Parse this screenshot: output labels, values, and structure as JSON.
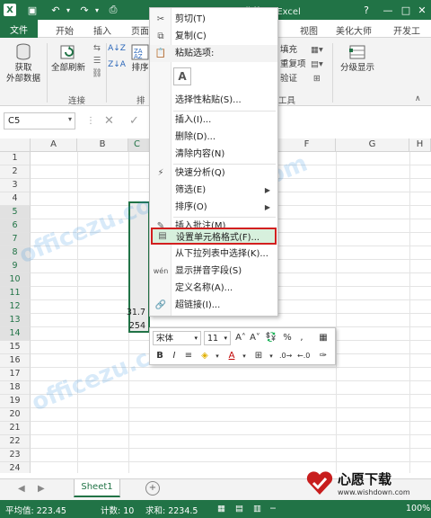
{
  "title_bar": {
    "title": "工作簿1 - Excel"
  },
  "ribbon_tabs": [
    "文件",
    "开始",
    "插入",
    "页面",
    "视图",
    "美化大师",
    "开发工"
  ],
  "ribbon": {
    "get_external": "获取\n外部数据",
    "refresh_all": "全部刷新",
    "group_connect": "连接",
    "sort": "排序",
    "group_sort_short": "排",
    "fill": "填充",
    "remove_dup": "重复项",
    "validate": "验证",
    "group_tools": "工具",
    "outline": "分级显示"
  },
  "formula_bar": {
    "name_box": "C5"
  },
  "columns": [
    "A",
    "B",
    "C",
    "D",
    "E",
    "F",
    "G",
    "H"
  ],
  "rows": [
    "1",
    "2",
    "3",
    "4",
    "5",
    "6",
    "7",
    "8",
    "9",
    "10",
    "11",
    "12",
    "13",
    "14",
    "15",
    "16",
    "17",
    "18",
    "19",
    "20",
    "21",
    "22",
    "23",
    "24"
  ],
  "visible_cell_values": {
    "row13": "31.7",
    "row14": "254"
  },
  "context_menu": {
    "items": [
      {
        "label": "剪切(T)",
        "icon": "scissors-icon"
      },
      {
        "label": "复制(C)",
        "icon": "copy-icon"
      },
      {
        "label": "粘贴选项:",
        "icon": "paste-icon"
      },
      {
        "label": "",
        "icon": "paste-a-icon"
      },
      {
        "label": "选择性粘贴(S)...",
        "icon": ""
      },
      {
        "label": "插入(I)...",
        "icon": ""
      },
      {
        "label": "删除(D)...",
        "icon": ""
      },
      {
        "label": "清除内容(N)",
        "icon": ""
      },
      {
        "label": "快速分析(Q)",
        "icon": "quick-analysis-icon"
      },
      {
        "label": "筛选(E)",
        "icon": ""
      },
      {
        "label": "排序(O)",
        "icon": ""
      },
      {
        "label": "插入批注(M)",
        "icon": "comment-icon"
      },
      {
        "label": "设置单元格格式(F)...",
        "icon": "format-cells-icon"
      },
      {
        "label": "从下拉列表中选择(K)...",
        "icon": ""
      },
      {
        "label": "显示拼音字段(S)",
        "icon": "phonetic-icon"
      },
      {
        "label": "定义名称(A)...",
        "icon": ""
      },
      {
        "label": "超链接(I)...",
        "icon": "hyperlink-icon"
      }
    ]
  },
  "mini_toolbar": {
    "font": "宋体",
    "size": "11",
    "pct": "%",
    "comma": ","
  },
  "sheet_tabs": [
    "Sheet1"
  ],
  "status": {
    "avg": "平均值: 223.45",
    "count": "计数: 10",
    "sum": "求和: 2234.5",
    "zoom": "100%"
  },
  "watermark": "officezu.com",
  "brand": {
    "name": "心愿下载",
    "url": "www.wishdown.com"
  },
  "colors": {
    "excel_green": "#217346",
    "highlight_border": "#d21f1f",
    "highlight_fill": "#d7f0dd"
  }
}
